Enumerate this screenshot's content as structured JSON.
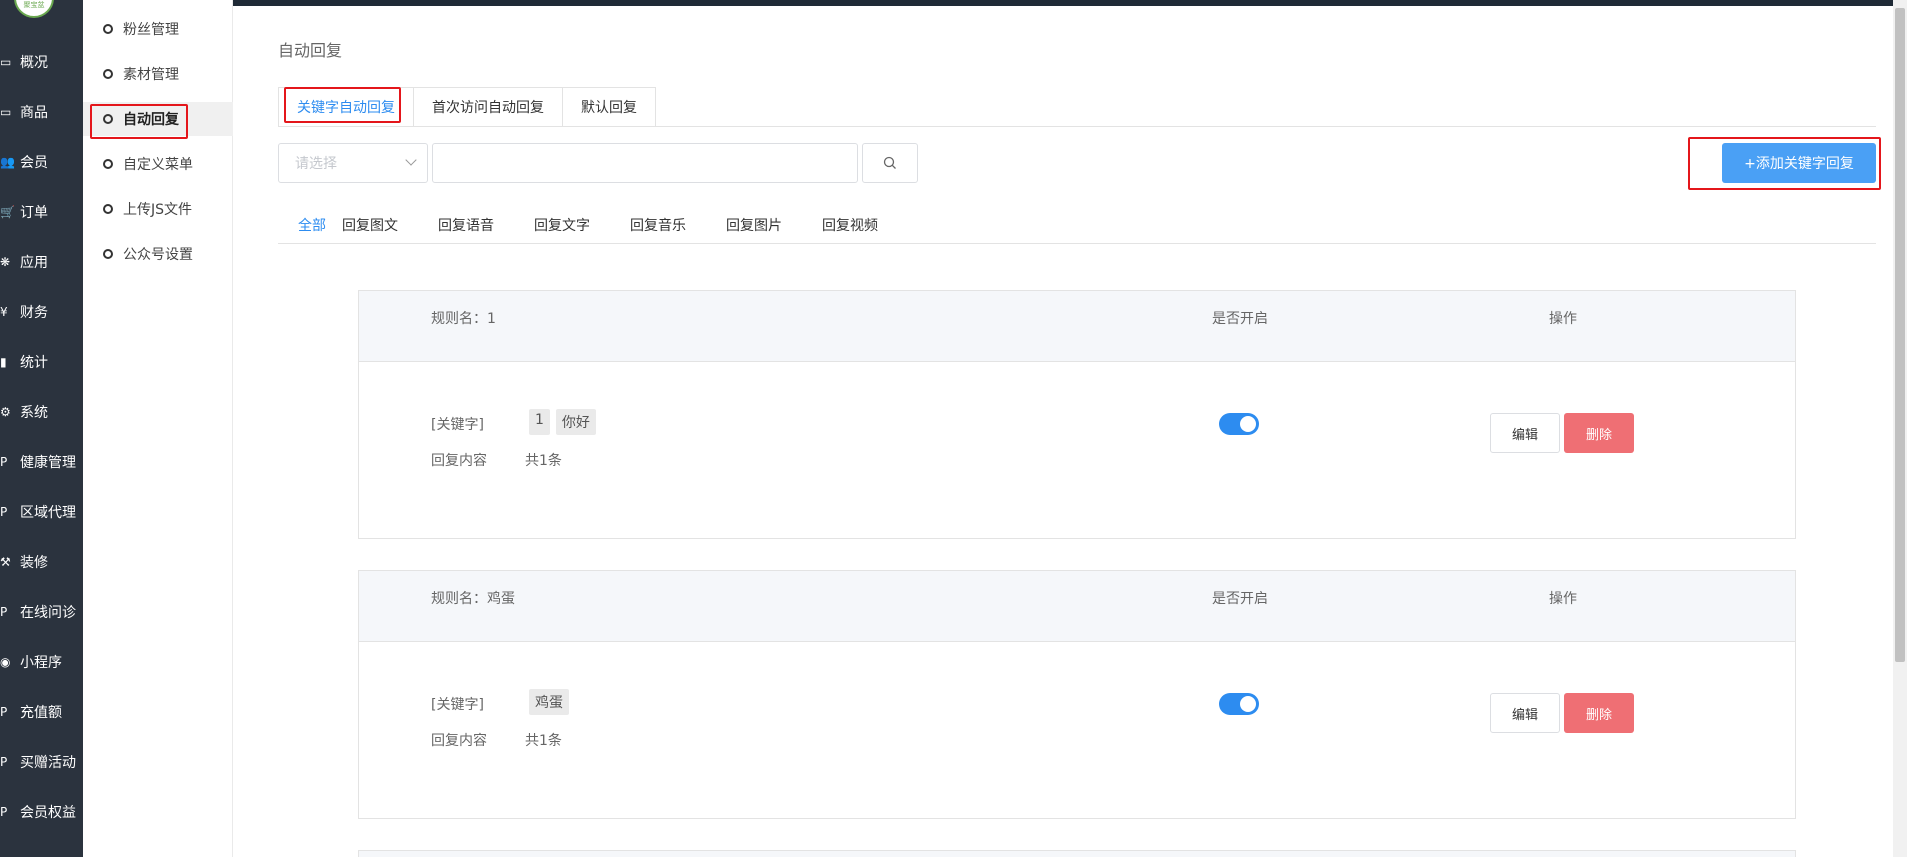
{
  "logo": {
    "text": "聚宝盆"
  },
  "nav_primary": [
    {
      "label": "概况",
      "icon": "dashboard-icon",
      "glyph": "▭"
    },
    {
      "label": "商品",
      "icon": "goods-icon",
      "glyph": "▭"
    },
    {
      "label": "会员",
      "icon": "users-icon",
      "glyph": "👥"
    },
    {
      "label": "订单",
      "icon": "cart-icon",
      "glyph": "🛒"
    },
    {
      "label": "应用",
      "icon": "apps-icon",
      "glyph": "❋"
    },
    {
      "label": "财务",
      "icon": "yen-icon",
      "glyph": "¥"
    },
    {
      "label": "统计",
      "icon": "bar-chart-icon",
      "glyph": "▮"
    },
    {
      "label": "系统",
      "icon": "gears-icon",
      "glyph": "⚙"
    },
    {
      "label": "健康管理",
      "icon": "paypal-icon",
      "glyph": "P"
    },
    {
      "label": "区域代理",
      "icon": "paypal-icon",
      "glyph": "P"
    },
    {
      "label": "装修",
      "icon": "hammer-icon",
      "glyph": "⚒"
    },
    {
      "label": "在线问诊",
      "icon": "paypal-icon",
      "glyph": "P"
    },
    {
      "label": "小程序",
      "icon": "wechat-icon",
      "glyph": "◉"
    },
    {
      "label": "充值额",
      "icon": "paypal-icon",
      "glyph": "P"
    },
    {
      "label": "买赠活动",
      "icon": "paypal-icon",
      "glyph": "P"
    },
    {
      "label": "会员权益",
      "icon": "paypal-icon",
      "glyph": "P"
    }
  ],
  "nav_secondary": [
    {
      "label": "粉丝管理"
    },
    {
      "label": "素材管理"
    },
    {
      "label": "自动回复"
    },
    {
      "label": "自定义菜单"
    },
    {
      "label": "上传JS文件"
    },
    {
      "label": "公众号设置"
    }
  ],
  "breadcrumb": "自动回复",
  "tabs": [
    {
      "label": "关键字自动回复",
      "active": true
    },
    {
      "label": "首次访问自动回复",
      "active": false
    },
    {
      "label": "默认回复",
      "active": false
    }
  ],
  "search": {
    "select_placeholder": "请选择",
    "input_value": ""
  },
  "add_button": "+添加关键字回复",
  "filters": [
    "全部",
    "回复图文",
    "回复语音",
    "回复文字",
    "回复音乐",
    "回复图片",
    "回复视频"
  ],
  "colors": {
    "accent": "#2d8cf0",
    "danger": "#ef6f74",
    "sidebar": "#2b333e",
    "highlight": "#e4161b"
  },
  "rules": [
    {
      "name": "规则名：1",
      "open_header": "是否开启",
      "op_header": "操作",
      "keyword_label": "[关键字]",
      "keywords": [
        "1",
        "你好"
      ],
      "reply_label": "回复内容",
      "reply_count": "共1条",
      "enabled": true,
      "edit_label": "编辑",
      "delete_label": "删除"
    },
    {
      "name": "规则名：鸡蛋",
      "open_header": "是否开启",
      "op_header": "操作",
      "keyword_label": "[关键字]",
      "keywords": [
        "鸡蛋"
      ],
      "reply_label": "回复内容",
      "reply_count": "共1条",
      "enabled": true,
      "edit_label": "编辑",
      "delete_label": "删除"
    }
  ]
}
